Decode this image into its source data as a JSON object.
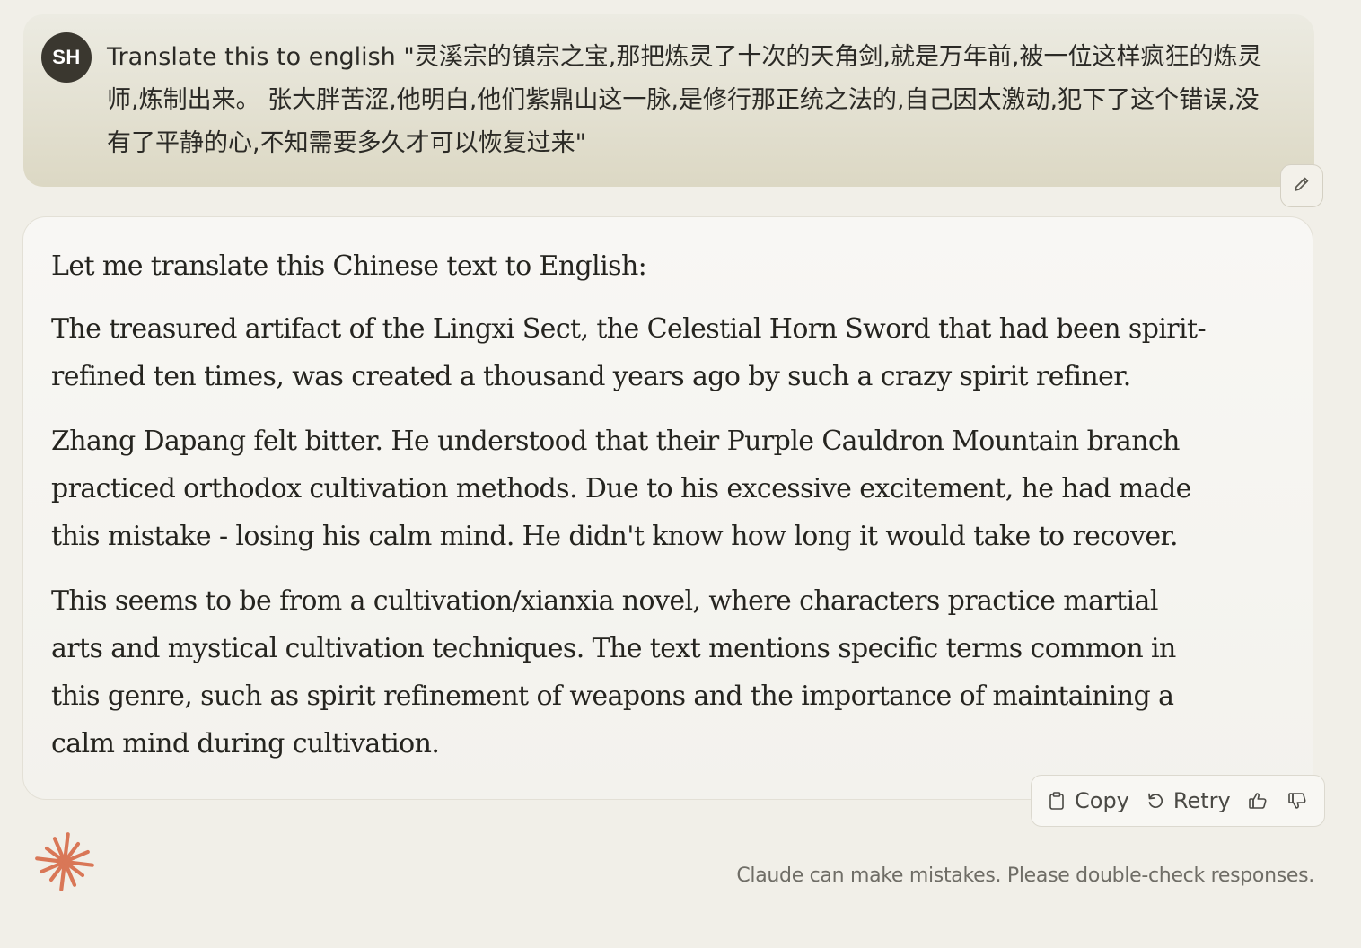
{
  "user_message": {
    "avatar_initials": "SH",
    "text": "Translate this to english \"灵溪宗的镇宗之宝,那把炼灵了十次的天角剑,就是万年前,被一位这样疯狂的炼灵师,炼制出来。 张大胖苦涩,他明白,他们紫鼎山这一脉,是修行那正统之法的,自己因太激动,犯下了这个错误,没有了平静的心,不知需要多久才可以恢复过来\"",
    "edit_icon": "pencil-icon"
  },
  "assistant_message": {
    "paragraphs": [
      "Let me translate this Chinese text to English:",
      "The treasured artifact of the Lingxi Sect, the Celestial Horn Sword that had been spirit-refined ten times, was created a thousand years ago by such a crazy spirit refiner.",
      "Zhang Dapang felt bitter. He understood that their Purple Cauldron Mountain branch practiced orthodox cultivation methods. Due to his excessive excitement, he had made this mistake - losing his calm mind. He didn't know how long it would take to recover.",
      "This seems to be from a cultivation/xianxia novel, where characters practice martial arts and mystical cultivation techniques. The text mentions specific terms common in this genre, such as spirit refinement of weapons and the importance of maintaining a calm mind during cultivation."
    ]
  },
  "actions": {
    "copy_label": "Copy",
    "retry_label": "Retry",
    "copy_icon": "clipboard-icon",
    "retry_icon": "retry-icon",
    "thumbs_up_icon": "thumbs-up-icon",
    "thumbs_down_icon": "thumbs-down-icon"
  },
  "footer": {
    "disclaimer": "Claude can make mistakes. Please double-check responses.",
    "logo_color": "#d97757"
  },
  "colors": {
    "background": "#f1efe8",
    "user_bubble": "#dcd8c4",
    "avatar": "#3a372f",
    "accent": "#d97757"
  }
}
